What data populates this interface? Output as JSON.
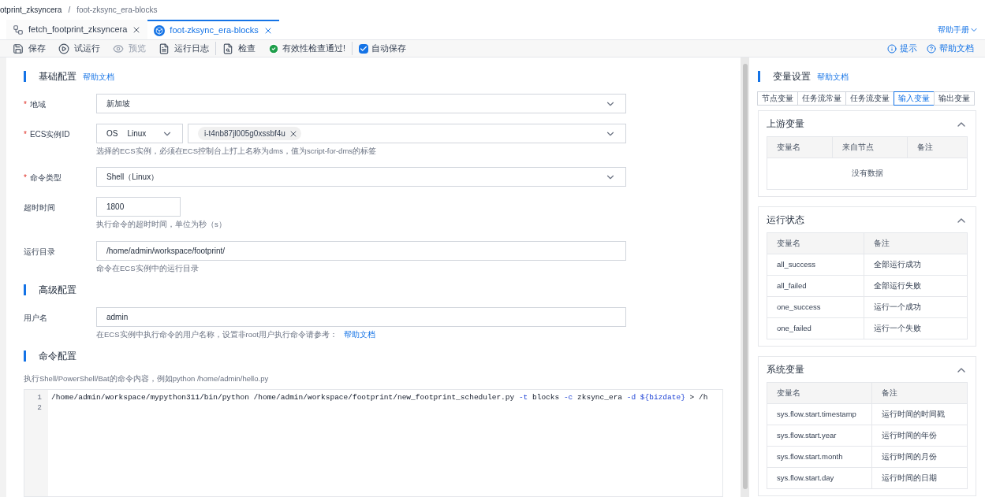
{
  "breadcrumb": [
    "otprint_zksyncera",
    "/",
    "foot-zksync_era-blocks"
  ],
  "tabs": [
    {
      "label": "fetch_footprint_zksyncera",
      "kind": "flow",
      "selected": false
    },
    {
      "label": "foot-zksync_era-blocks",
      "kind": "node",
      "selected": true
    }
  ],
  "help_manual": "帮助手册",
  "toolbar": [
    {
      "label": "保存",
      "kind": "save"
    },
    {
      "label": "试运行",
      "kind": "run"
    },
    {
      "label": "预览",
      "kind": "preview",
      "disabled": true
    },
    {
      "label": "运行日志",
      "kind": "log"
    },
    {
      "label": "检查",
      "kind": "check"
    },
    {
      "label": "有效性检查通过!",
      "kind": "status"
    },
    {
      "label": "自动保存",
      "kind": "checkbox",
      "checked": true
    }
  ],
  "toolbar_right": [
    {
      "label": "提示",
      "kind": "info"
    },
    {
      "label": "帮助文档",
      "kind": "help"
    }
  ],
  "sections": [
    {
      "title": "基础配置",
      "link": "帮助文档",
      "fields": [
        {
          "label": "地域",
          "required_mark": "*",
          "kind": "select",
          "value": "新加坡"
        },
        {
          "label": "ECS实例ID",
          "required_mark": "*",
          "kind": "os-tags",
          "os_label": "OS",
          "os_value": "Linux",
          "tags": [
            "i-t4nb87jl005g0xssbf4u"
          ],
          "hint": "选择的ECS实例，必须在ECS控制台上打上名称为dms，值为script-for-dms的标签"
        },
        {
          "label": "命令类型",
          "required_mark": "*",
          "kind": "select",
          "value": "Shell（Linux）"
        },
        {
          "label": "超时时间",
          "kind": "short",
          "value": "1800",
          "hint": "执行命令的超时时间，单位为秒（s）"
        },
        {
          "label": "运行目录",
          "kind": "text",
          "value": "/home/admin/workspace/footprint/",
          "hint": "命令在ECS实例中的运行目录"
        }
      ]
    },
    {
      "title": "高级配置",
      "fields": [
        {
          "label": "用户名",
          "kind": "text",
          "value": "admin",
          "hint": "在ECS实例中执行命令的用户名称，设置非root用户执行命令请参考：",
          "hint_link": "帮助文档"
        }
      ]
    },
    {
      "title": "命令配置",
      "description": "执行Shell/PowerShell/Bat的命令内容，例如python /home/admin/hello.py",
      "code": [
        {
          "number": "1",
          "tokens": [
            {
              "text": "/home/admin/workspace/mypython311/bin/python /home/admin/workspace/footprint/new_footprint_scheduler.py ",
              "kind": "plain"
            },
            {
              "text": "-t",
              "kind": "flag"
            },
            {
              "text": " blocks ",
              "kind": "plain"
            },
            {
              "text": "-c",
              "kind": "flag"
            },
            {
              "text": " zksync_era ",
              "kind": "plain"
            },
            {
              "text": "-d ${bizdate}",
              "kind": "flag"
            },
            {
              "text": " > /h",
              "kind": "plain"
            }
          ]
        },
        {
          "number": "2"
        }
      ]
    }
  ],
  "variables": {
    "title": "变量设置",
    "link": "帮助文档",
    "tabs": [
      {
        "label": "节点变量",
        "selected": false
      },
      {
        "label": "任务流常量",
        "selected": false
      },
      {
        "label": "任务流变量",
        "selected": false
      },
      {
        "label": "输入变量",
        "selected": true
      },
      {
        "label": "输出变量",
        "selected": false
      }
    ],
    "panels": [
      {
        "title": "上游变量",
        "expanded": true,
        "columns": [
          "变量名",
          "来自节点",
          "备注"
        ],
        "empty_text": "没有数据"
      },
      {
        "title": "运行状态",
        "expanded": true,
        "columns": [
          "变量名",
          "备注"
        ],
        "rows": [
          [
            "all_success",
            "全部运行成功"
          ],
          [
            "all_failed",
            "全部运行失败"
          ],
          [
            "one_success",
            "运行一个成功"
          ],
          [
            "one_failed",
            "运行一个失败"
          ]
        ]
      },
      {
        "title": "系统变量",
        "expanded": true,
        "columns": [
          "变量名",
          "备注"
        ],
        "rows": [
          [
            "sys.flow.start.timestamp",
            "运行时间的时间戳"
          ],
          [
            "sys.flow.start.year",
            "运行时间的年份"
          ],
          [
            "sys.flow.start.month",
            "运行时间的月份"
          ],
          [
            "sys.flow.start.day",
            "运行时间的日期"
          ]
        ]
      }
    ]
  }
}
